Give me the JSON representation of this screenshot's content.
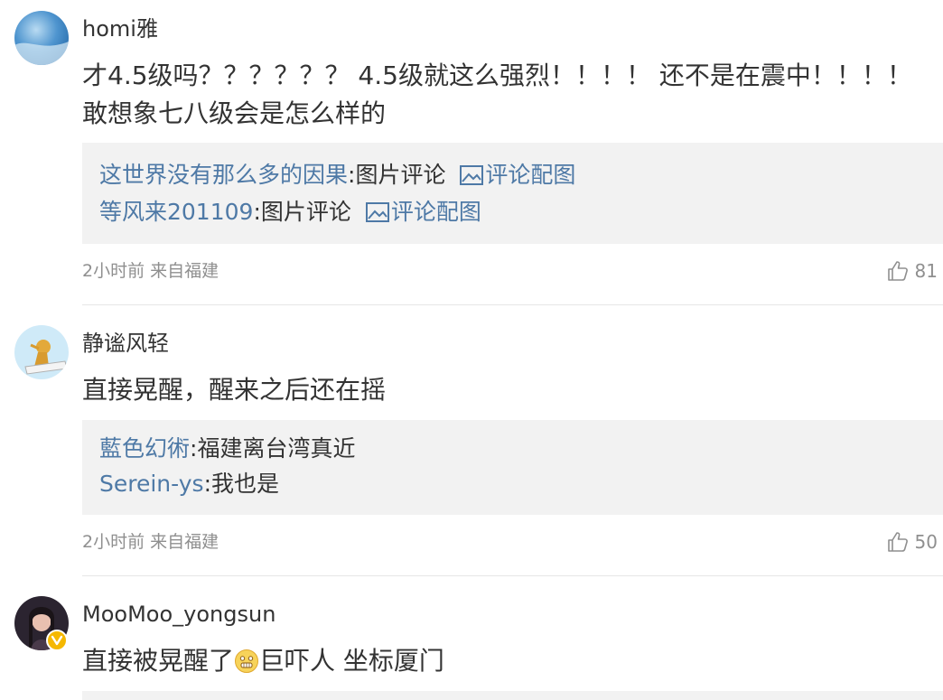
{
  "comments": [
    {
      "username": "homi雅",
      "text_line1": "才4.5级吗？？？？？？ 4.5级就这么强烈！！！！ 还不是在震中！！！！",
      "text_line2": "敢想象七八级会是怎么样的",
      "replies": [
        {
          "user": "这世界没有那么多的因果",
          "sep": ":",
          "text": "图片评论",
          "link": "评论配图"
        },
        {
          "user": "等风来201109",
          "sep": ":",
          "text": "图片评论",
          "link": "评论配图"
        }
      ],
      "time": "2小时前 来自福建",
      "likes": "81"
    },
    {
      "username": "静谧风轻",
      "text": "直接晃醒，醒来之后还在摇",
      "replies": [
        {
          "user": "藍色幻術",
          "sep": ":",
          "text": "福建离台湾真近"
        },
        {
          "user": "Serein-ys",
          "sep": ":",
          "text": "我也是"
        }
      ],
      "time": "2小时前 来自福建",
      "likes": "50"
    },
    {
      "username": "MooMoo_yongsun",
      "text_before": "直接被晃醒了",
      "emoji": "grimace-emoji",
      "text_after": "巨吓人 坐标厦门"
    }
  ],
  "icons": {
    "like": "thumbs-up-icon",
    "picture": "picture-icon",
    "vip": "vip-badge-icon"
  },
  "colors": {
    "link": "#4e79a6",
    "meta": "#8f8f8f",
    "reply_bg": "#f2f2f2",
    "text": "#333333"
  }
}
